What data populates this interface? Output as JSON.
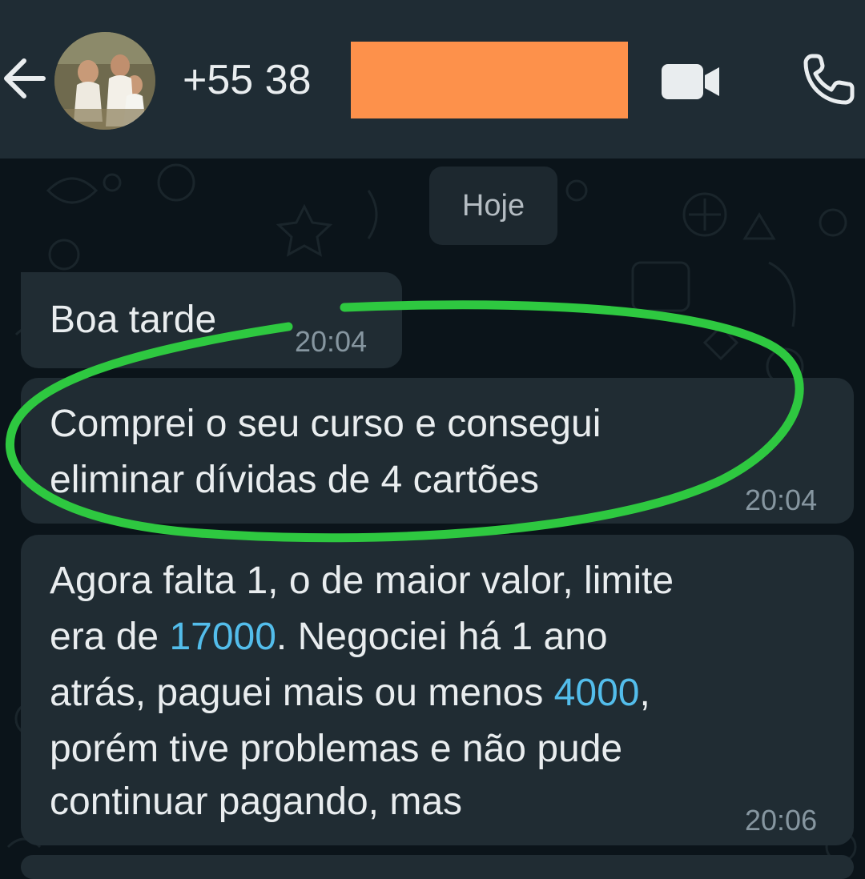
{
  "header": {
    "back_icon": "arrow-left-icon",
    "contact_name": "+55 38",
    "video_icon": "video-camera-icon",
    "call_icon": "phone-icon"
  },
  "chat": {
    "date_chip": "Hoje",
    "messages": [
      {
        "text": "Boa tarde",
        "time": "20:04"
      },
      {
        "lines": [
          "Comprei o seu curso e consegui",
          "eliminar dívidas de 4 cartões"
        ],
        "time": "20:04"
      },
      {
        "line1": "Agora falta 1, o de maior valor, limite",
        "line2_pre": "era de ",
        "line2_num": "17000",
        "line2_post": ". Negociei há 1 ano",
        "line3_pre": "atrás, paguei mais ou menos ",
        "line3_num": "4000",
        "line3_post": ",",
        "line4": "porém tive problemas e não pude",
        "line5": "continuar pagando, mas",
        "time": "20:06"
      }
    ]
  },
  "colors": {
    "header_bg": "#1f2c34",
    "chat_bg": "#0b141a",
    "bubble_bg": "#202c33",
    "link_number": "#53bdeb",
    "highlight_circle": "#2ec840",
    "redaction": "#fd914b"
  }
}
